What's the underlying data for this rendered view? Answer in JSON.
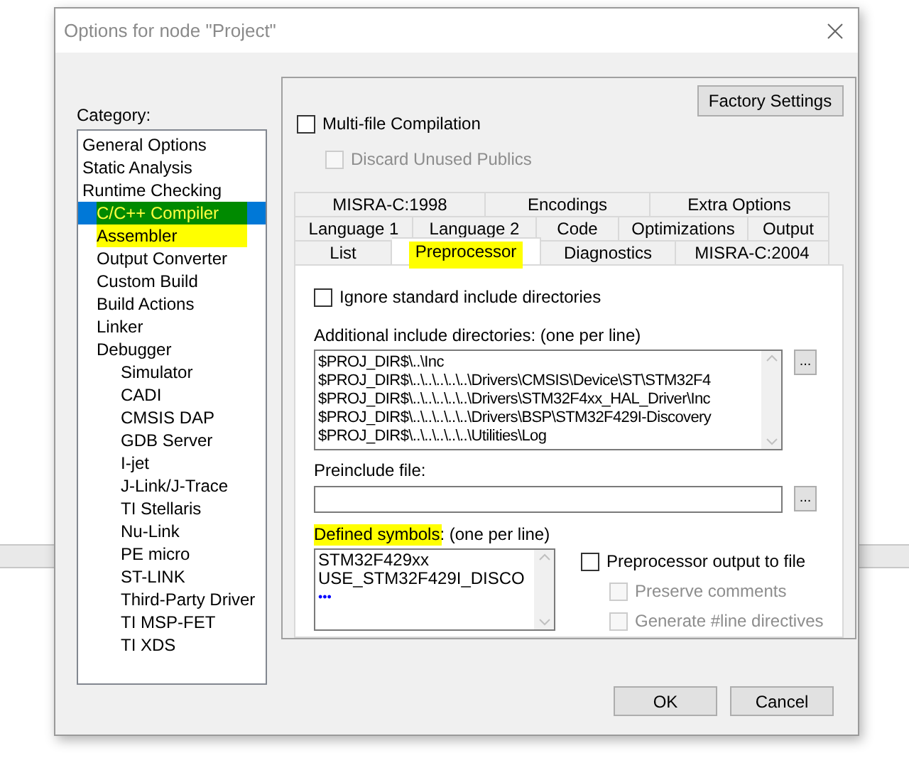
{
  "window": {
    "title": "Options for node \"Project\""
  },
  "category": {
    "label": "Category:",
    "items": [
      {
        "label": "General Options",
        "selected": false,
        "highlighted": false
      },
      {
        "label": "Static Analysis",
        "selected": false,
        "highlighted": false
      },
      {
        "label": "Runtime Checking",
        "selected": false,
        "highlighted": false
      },
      {
        "label": "C/C++ Compiler",
        "selected": true,
        "highlighted": true,
        "indented": true
      },
      {
        "label": "Assembler",
        "selected": false,
        "highlighted": true,
        "indented": true
      },
      {
        "label": "Output Converter",
        "selected": false,
        "highlighted": false,
        "indented": true
      },
      {
        "label": "Custom Build",
        "selected": false,
        "highlighted": false,
        "indented": true
      },
      {
        "label": "Build Actions",
        "selected": false,
        "highlighted": false,
        "indented": true
      },
      {
        "label": "Linker",
        "selected": false,
        "highlighted": false,
        "indented": true
      },
      {
        "label": "Debugger",
        "selected": false,
        "highlighted": false,
        "indented": true,
        "children": [
          {
            "label": "Simulator",
            "selected": false,
            "highlighted": false
          },
          {
            "label": "CADI",
            "selected": false,
            "highlighted": false
          },
          {
            "label": "CMSIS DAP",
            "selected": false,
            "highlighted": false
          },
          {
            "label": "GDB Server",
            "selected": false,
            "highlighted": false
          },
          {
            "label": "I-jet",
            "selected": false,
            "highlighted": false
          },
          {
            "label": "J-Link/J-Trace",
            "selected": false,
            "highlighted": false
          },
          {
            "label": "TI Stellaris",
            "selected": false,
            "highlighted": false
          },
          {
            "label": "Nu-Link",
            "selected": false,
            "highlighted": false
          },
          {
            "label": "PE micro",
            "selected": false,
            "highlighted": false
          },
          {
            "label": "ST-LINK",
            "selected": false,
            "highlighted": false
          },
          {
            "label": "Third-Party Driver",
            "selected": false,
            "highlighted": false
          },
          {
            "label": "TI MSP-FET",
            "selected": false,
            "highlighted": false
          },
          {
            "label": "TI XDS",
            "selected": false,
            "highlighted": false
          }
        ]
      }
    ]
  },
  "factory_settings_button": "Factory Settings",
  "options": [
    {
      "label": "Multi-file Compilation",
      "checked": false,
      "disabled": false,
      "children": [
        {
          "label": "Discard Unused Publics",
          "checked": false,
          "disabled": true
        }
      ]
    }
  ],
  "tab_rows": [
    [
      {
        "label": "MISRA-C:1998",
        "selected": false,
        "highlighted": false
      },
      {
        "label": "Encodings",
        "selected": false,
        "highlighted": false
      },
      {
        "label": "Extra Options",
        "selected": false,
        "highlighted": false
      }
    ],
    [
      {
        "label": "Language 1",
        "selected": false,
        "highlighted": false
      },
      {
        "label": "Language 2",
        "selected": false,
        "highlighted": false
      },
      {
        "label": "Code",
        "selected": false,
        "highlighted": false
      },
      {
        "label": "Optimizations",
        "selected": false,
        "highlighted": false
      },
      {
        "label": "Output",
        "selected": false,
        "highlighted": false
      }
    ],
    [
      {
        "label": "List",
        "selected": false,
        "highlighted": false
      },
      {
        "label": "Preprocessor",
        "selected": true,
        "highlighted": true
      },
      {
        "label": "Diagnostics",
        "selected": false,
        "highlighted": false
      },
      {
        "label": "MISRA-C:2004",
        "selected": false,
        "highlighted": false
      }
    ]
  ],
  "preprocessor": {
    "ignore_standard": {
      "label": "Ignore standard include directories",
      "checked": false
    },
    "include_dirs": {
      "label": "Additional include directories: (one per line)",
      "lines": [
        "$PROJ_DIR$\\..\\Inc",
        "$PROJ_DIR$\\..\\..\\..\\..\\..\\Drivers\\CMSIS\\Device\\ST\\STM32F4",
        "$PROJ_DIR$\\..\\..\\..\\..\\..\\Drivers\\STM32F4xx_HAL_Driver\\Inc",
        "$PROJ_DIR$\\..\\..\\..\\..\\..\\Drivers\\BSP\\STM32F429I-Discovery",
        "$PROJ_DIR$\\..\\..\\..\\..\\..\\Utilities\\Log"
      ],
      "browse": "..."
    },
    "preinclude": {
      "label": "Preinclude file:",
      "browse": "..."
    },
    "defined_symbols": {
      "label": "Defined symbols: (one per line)",
      "highlighted": true,
      "lines": [
        "STM32F429xx",
        "USE_STM32F429I_DISCO"
      ],
      "more": "•••"
    },
    "output_options": [
      {
        "label": "Preprocessor output to file",
        "checked": false,
        "disabled": false,
        "children": [
          {
            "label": "Preserve comments",
            "checked": false,
            "disabled": true
          },
          {
            "label": "Generate #line directives",
            "checked": false,
            "disabled": true
          }
        ]
      }
    ]
  },
  "buttons": [
    "OK",
    "Cancel"
  ]
}
